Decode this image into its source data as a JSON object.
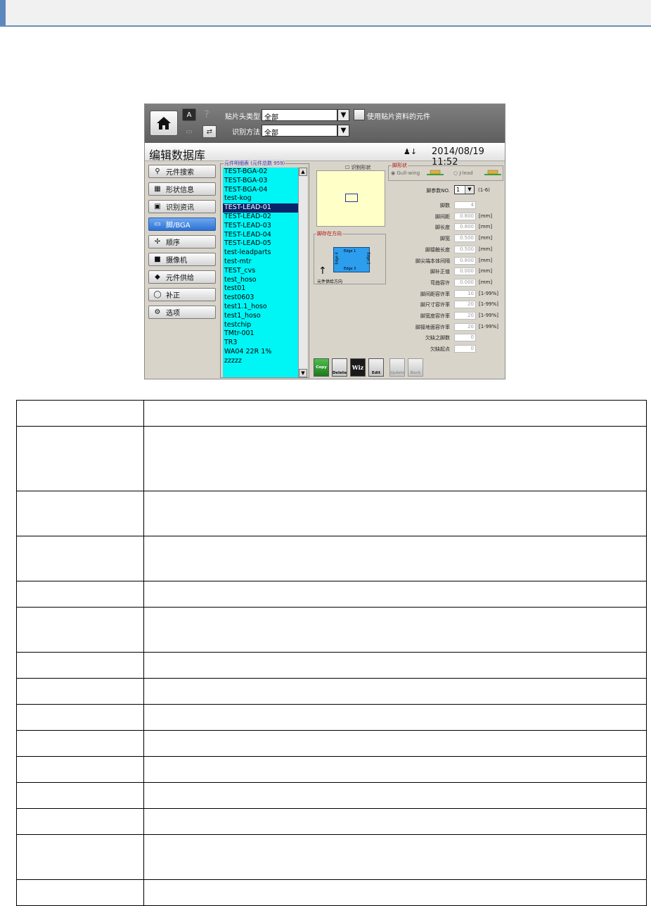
{
  "toolbar": {
    "head_type_label": "贴片头类型",
    "head_type_value": "全部",
    "recog_method_label": "识别方法",
    "recog_method_value": "全部",
    "use_patch_data_label": "使用贴片资料的元件",
    "help_icon": "?",
    "dropdown_icon": "▼"
  },
  "title_bar": {
    "title": "编辑数据库",
    "datetime": "2014/08/19 11:52"
  },
  "nav": {
    "items": [
      {
        "label": "元件搜索",
        "icon": "search-icon"
      },
      {
        "label": "形状信息",
        "icon": "shape-icon"
      },
      {
        "label": "识别资讯",
        "icon": "recog-icon"
      },
      {
        "label": "脚/BGA",
        "icon": "lead-icon"
      },
      {
        "label": "顺序",
        "icon": "order-icon"
      },
      {
        "label": "摄像机",
        "icon": "camera-icon"
      },
      {
        "label": "元件供给",
        "icon": "feeder-icon"
      },
      {
        "label": "补正",
        "icon": "correction-icon"
      },
      {
        "label": "选项",
        "icon": "options-icon"
      }
    ],
    "active_index": 3
  },
  "component_list": {
    "title": "元件明细表 (元件总数 959)",
    "items": [
      "TEST-BGA-02",
      "TEST-BGA-03",
      "TEST-BGA-04",
      "test-kog",
      "TEST-LEAD-01",
      "TEST-LEAD-02",
      "TEST-LEAD-03",
      "TEST-LEAD-04",
      "TEST-LEAD-05",
      "test-leadparts",
      "test-mtr",
      "TEST_cvs",
      "test_hoso",
      "test01",
      "test0603",
      "test1.1_hoso",
      "test1_hoso",
      "testchip",
      "TMtr-001",
      "TR3",
      "WA04 22R 1%",
      "zzzzz"
    ],
    "selected": "TEST-LEAD-01"
  },
  "recog_shape": {
    "label": "识别形状"
  },
  "lead_direction": {
    "title": "脚存在方向",
    "edges": [
      "Edge 1",
      "Edge 2",
      "Edge 3",
      "Edge 4"
    ],
    "feed_label": "元件供给方向"
  },
  "lead_shape": {
    "title": "脚形状",
    "options": [
      "Gull-wing",
      "J-lead"
    ],
    "selected": "Gull-wing"
  },
  "params": {
    "pin_param_label": "脚参数NO.",
    "pin_param_value": "1",
    "pin_param_range": "(1-6)",
    "rows": [
      {
        "label": "脚数",
        "value": "4",
        "unit": ""
      },
      {
        "label": "脚间距",
        "value": "0.800",
        "unit": "[mm]"
      },
      {
        "label": "脚长度",
        "value": "0.800",
        "unit": "[mm]"
      },
      {
        "label": "脚宽",
        "value": "0.500",
        "unit": "[mm]"
      },
      {
        "label": "脚接触长度",
        "value": "0.500",
        "unit": "[mm]"
      },
      {
        "label": "脚尖端本体间隔",
        "value": "0.800",
        "unit": "[mm]"
      },
      {
        "label": "脚补正值",
        "value": "0.000",
        "unit": "[mm]"
      },
      {
        "label": "弯曲容许",
        "value": "0.000",
        "unit": "[mm]"
      },
      {
        "label": "脚间距容许率",
        "value": "10",
        "unit": "[1-99%]"
      },
      {
        "label": "脚尺寸容许率",
        "value": "20",
        "unit": "[1-99%]"
      },
      {
        "label": "脚宽度容许率",
        "value": "20",
        "unit": "[1-99%]"
      },
      {
        "label": "脚接地面容许率",
        "value": "20",
        "unit": "[1-99%]"
      },
      {
        "label": "欠缺之脚数",
        "value": "0",
        "unit": ""
      },
      {
        "label": "欠缺起点",
        "value": "0",
        "unit": ""
      }
    ]
  },
  "actions": {
    "copy": "Copy",
    "delete": "Delete",
    "wiz": "Wiz",
    "edit": "Edit",
    "update": "Update",
    "back": "Back"
  },
  "colors": {
    "list_bg": "#00f5f5",
    "active_nav": "#2d71d4",
    "preview_bg": "#ffffc8",
    "chip": "#2d9ded"
  }
}
